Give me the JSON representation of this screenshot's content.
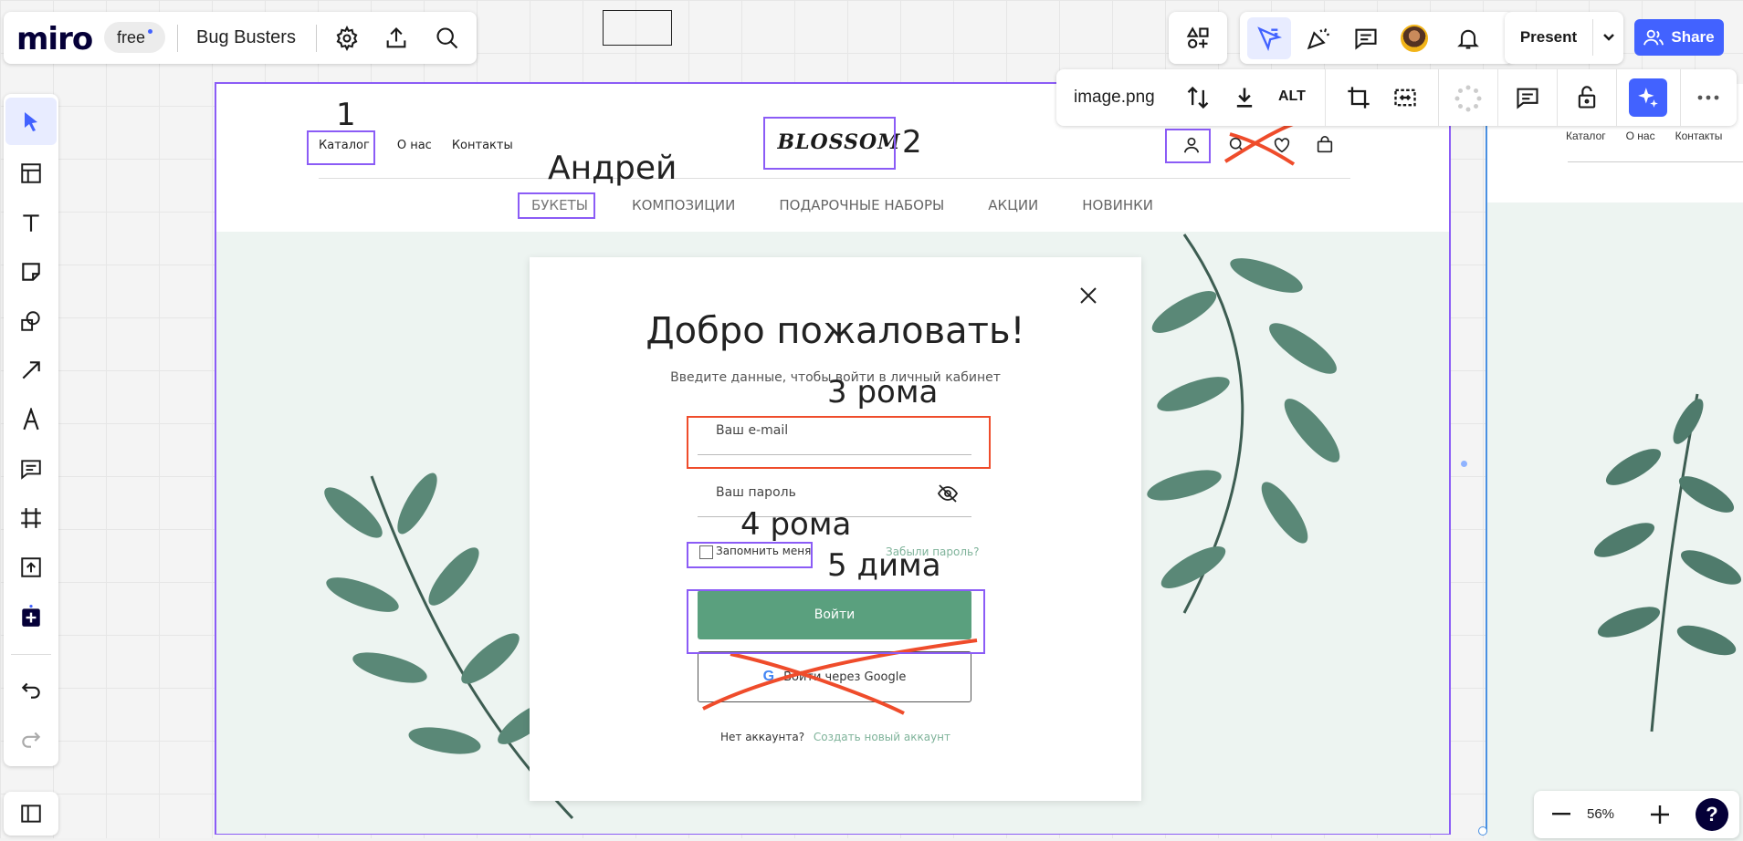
{
  "app": {
    "logo": "miro",
    "plan_badge": "free",
    "board_name": "Bug Busters"
  },
  "right_toolbar": {
    "present_label": "Present",
    "share_label": "Share"
  },
  "image_toolbar": {
    "filename": "image.png",
    "alt_label": "ALT"
  },
  "zoom": {
    "level": "56%",
    "help": "?"
  },
  "mockup": {
    "top_nav": [
      "Каталог",
      "О нас",
      "Контакты"
    ],
    "logo_text": "BLOSSOM",
    "categories": [
      "БУКЕТЫ",
      "КОМПОЗИЦИИ",
      "ПОДАРОЧНЫЕ НАБОРЫ",
      "АКЦИИ",
      "НОВИНКИ"
    ],
    "modal": {
      "title": "Добро пожаловать!",
      "subtitle": "Введите данные, чтобы войти в личный кабинет",
      "email_placeholder": "Ваш e-mail",
      "password_placeholder": "Ваш пароль",
      "remember": "Запомнить меня",
      "forgot": "Забыли пароль?",
      "login_button": "Войти",
      "google_button": "Войти через Google",
      "no_account": "Нет аккаунта?",
      "create_account": "Создать новый аккаунт"
    },
    "right_preview_nav": [
      "Каталог",
      "О нас",
      "Контакты"
    ]
  },
  "annotations": {
    "a1": "1",
    "a2": "2",
    "andrey": "Андрей",
    "roma3": "3 рома",
    "roma4": "4 рома",
    "dima5": "5 дима"
  },
  "colors": {
    "accent_blue": "#4262ff",
    "selection_purple": "#8b5cf6",
    "button_green": "#5aa07e",
    "error_red": "#ef4c2b"
  }
}
